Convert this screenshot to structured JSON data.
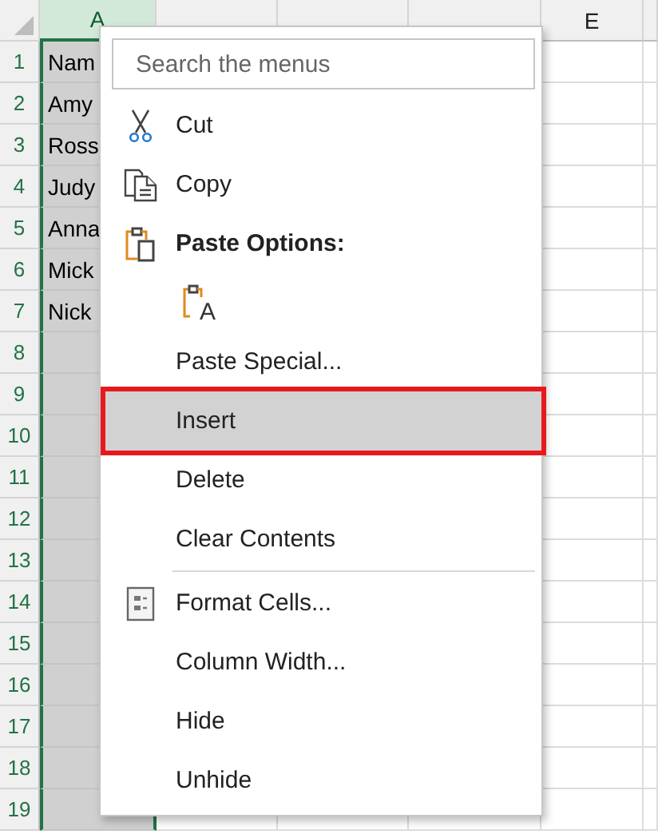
{
  "sheet": {
    "columns": [
      {
        "label": "A",
        "selected": true
      },
      {
        "selected": false
      },
      {
        "selected": false
      },
      {
        "selected": false
      },
      {
        "label": "E",
        "selected": false
      }
    ],
    "rows": [
      {
        "number": "1",
        "cells": [
          "Nam"
        ]
      },
      {
        "number": "2",
        "cells": [
          "Amy"
        ]
      },
      {
        "number": "3",
        "cells": [
          "Ross"
        ]
      },
      {
        "number": "4",
        "cells": [
          "Judy"
        ]
      },
      {
        "number": "5",
        "cells": [
          "Anna"
        ]
      },
      {
        "number": "6",
        "cells": [
          "Mick"
        ]
      },
      {
        "number": "7",
        "cells": [
          "Nick"
        ]
      },
      {
        "number": "8"
      },
      {
        "number": "9"
      },
      {
        "number": "10"
      },
      {
        "number": "11"
      },
      {
        "number": "12"
      },
      {
        "number": "13"
      },
      {
        "number": "14"
      },
      {
        "number": "15"
      },
      {
        "number": "16"
      },
      {
        "number": "17"
      },
      {
        "number": "18"
      },
      {
        "number": "19"
      }
    ]
  },
  "context_menu": {
    "search": {
      "placeholder": "Search the menus"
    },
    "items": [
      {
        "kind": "command",
        "label": "Cut",
        "selected": false
      },
      {
        "kind": "command",
        "label": "Copy",
        "selected": false
      },
      {
        "kind": "header",
        "label": "Paste Options:"
      },
      {
        "kind": "paste-buttons",
        "buttons": [
          "A"
        ]
      },
      {
        "kind": "command",
        "label": "Paste Special...",
        "selected": false
      },
      {
        "kind": "command",
        "label": "Insert",
        "selected": true
      },
      {
        "kind": "command",
        "label": "Delete",
        "selected": false
      },
      {
        "kind": "command",
        "label": "Clear Contents",
        "selected": false
      },
      {
        "kind": "separator"
      },
      {
        "kind": "command",
        "label": "Format Cells...",
        "selected": false
      },
      {
        "kind": "command",
        "label": "Column Width...",
        "selected": false
      },
      {
        "kind": "command",
        "label": "Hide",
        "selected": false
      },
      {
        "kind": "command",
        "label": "Unhide",
        "selected": false
      }
    ]
  }
}
